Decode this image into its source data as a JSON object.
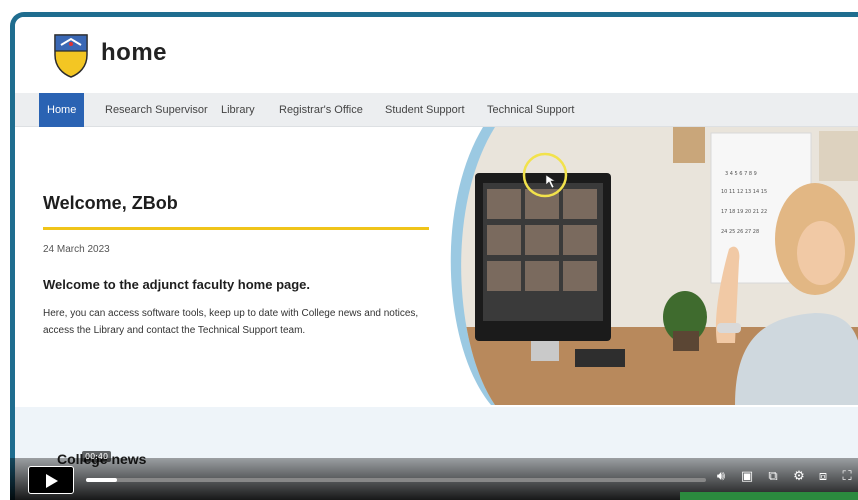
{
  "site": {
    "title": "home"
  },
  "nav": {
    "items": [
      {
        "label": "Home",
        "active": true
      },
      {
        "label": "Research Supervisor"
      },
      {
        "label": "Library"
      },
      {
        "label": "Registrar's Office"
      },
      {
        "label": "Student Support"
      },
      {
        "label": "Technical Support"
      }
    ]
  },
  "hero": {
    "title": "Welcome, ZBob",
    "date": "24 March 2023",
    "subtitle": "Welcome to the adjunct faculty home page.",
    "body": "Here, you can access software tools, keep up to date with College news and notices, access the Library and contact the Technical Support team."
  },
  "news": {
    "title": "College news"
  },
  "player": {
    "time": "00:40",
    "progress": 0.05,
    "controls": [
      "volume-icon",
      "captions-icon",
      "transcript-icon",
      "settings-icon",
      "pip-icon",
      "fullscreen-icon"
    ]
  },
  "colors": {
    "frame": "#1f6d8f",
    "nav_active": "#2a63b3",
    "accent_rule": "#f0c419",
    "photo_arc": "#9bc9e2"
  }
}
